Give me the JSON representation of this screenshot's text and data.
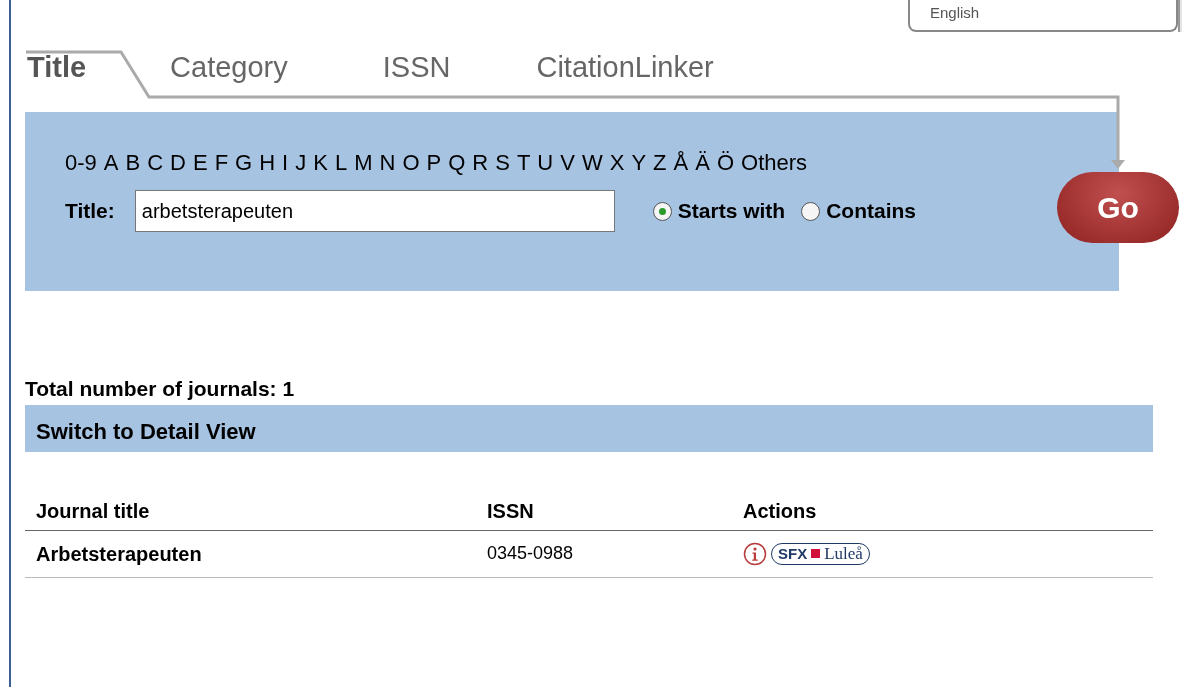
{
  "language_select": {
    "value": "English"
  },
  "tabs": [
    {
      "label": "Title",
      "selected": true
    },
    {
      "label": "Category",
      "selected": false
    },
    {
      "label": "ISSN",
      "selected": false
    },
    {
      "label": "CitationLinker",
      "selected": false
    }
  ],
  "letters": [
    "0-9",
    "A",
    "B",
    "C",
    "D",
    "E",
    "F",
    "G",
    "H",
    "I",
    "J",
    "K",
    "L",
    "M",
    "N",
    "O",
    "P",
    "Q",
    "R",
    "S",
    "T",
    "U",
    "V",
    "W",
    "X",
    "Y",
    "Z",
    "Å",
    "Ä",
    "Ö",
    "Others"
  ],
  "search": {
    "label": "Title:",
    "value": "arbetsterapeuten"
  },
  "match_options": [
    {
      "label": "Starts with",
      "selected": true
    },
    {
      "label": "Contains",
      "selected": false
    }
  ],
  "go_button": "Go",
  "total": "Total number of journals: 1",
  "switch_view": "Switch to Detail View",
  "table": {
    "columns": [
      "Journal title",
      "ISSN",
      "Actions"
    ],
    "rows": [
      {
        "title": "Arbetsterapeuten",
        "issn": "0345-0988",
        "sfx_label": "SFX",
        "library": "Luleå"
      }
    ]
  }
}
